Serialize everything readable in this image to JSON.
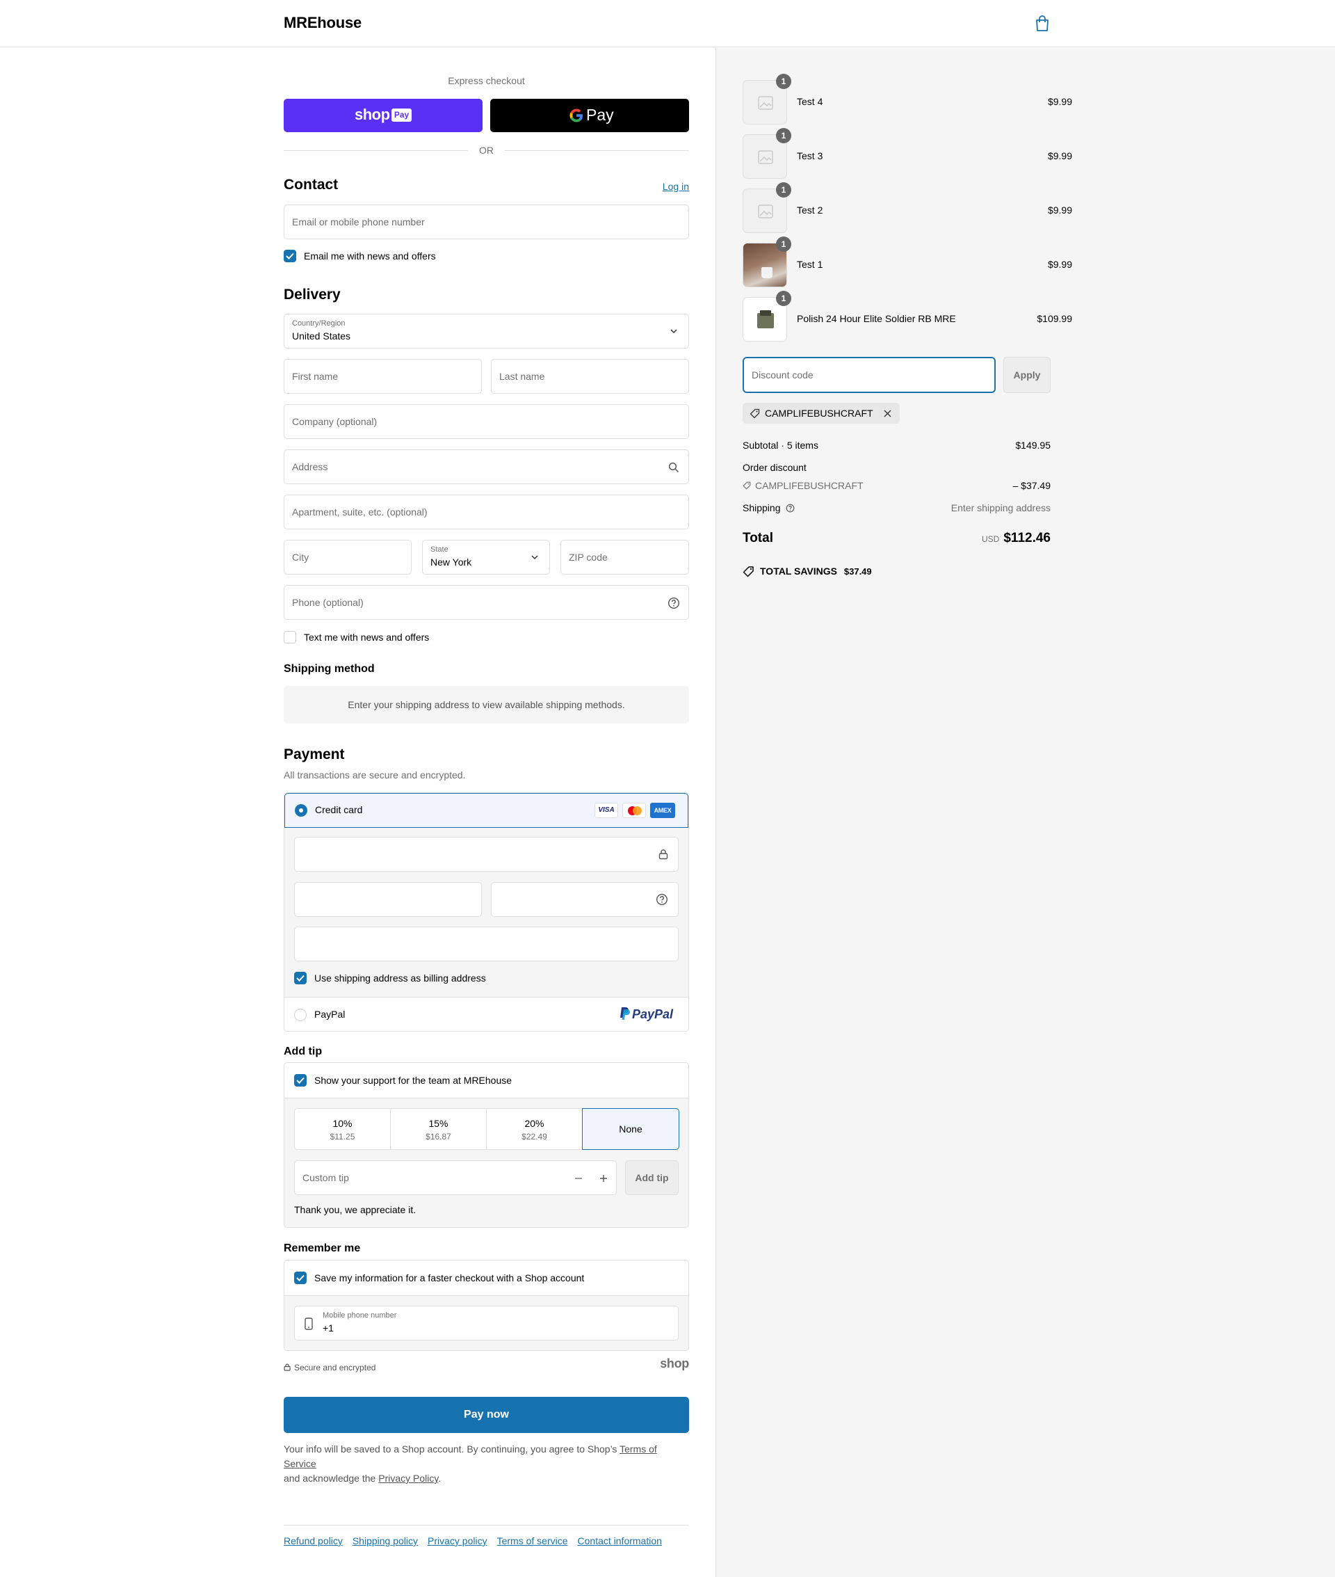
{
  "header": {
    "store_name": "MREhouse"
  },
  "express": {
    "title": "Express checkout",
    "shop_pay_word": "shop",
    "shop_pay_badge": "Pay",
    "gpay_word": "Pay",
    "or": "OR"
  },
  "contact": {
    "title": "Contact",
    "login": "Log in",
    "email_placeholder": "Email or mobile phone number",
    "news_label": "Email me with news and offers"
  },
  "delivery": {
    "title": "Delivery",
    "country_label": "Country/Region",
    "country_value": "United States",
    "first_name": "First name",
    "last_name": "Last name",
    "company": "Company (optional)",
    "address": "Address",
    "apartment": "Apartment, suite, etc. (optional)",
    "city": "City",
    "state_label": "State",
    "state_value": "New York",
    "zip": "ZIP code",
    "phone": "Phone (optional)",
    "text_label": "Text me with news and offers"
  },
  "shipping_method": {
    "title": "Shipping method",
    "notice": "Enter your shipping address to view available shipping methods."
  },
  "payment": {
    "title": "Payment",
    "subtitle": "All transactions are secure and encrypted.",
    "credit_card": "Credit card",
    "visa": "VISA",
    "amex": "AMEX",
    "billing_label": "Use shipping address as billing address",
    "paypal": "PayPal",
    "paypal_logo": "PayPal"
  },
  "tip": {
    "title": "Add tip",
    "support_label": "Show your support for the team at MREhouse",
    "options": [
      {
        "pct": "10%",
        "amt": "$11.25"
      },
      {
        "pct": "15%",
        "amt": "$16.87"
      },
      {
        "pct": "20%",
        "amt": "$22.49"
      },
      {
        "pct": "None",
        "amt": ""
      }
    ],
    "selected": "None",
    "custom_placeholder": "Custom tip",
    "add_button": "Add tip",
    "thanks": "Thank you, we appreciate it."
  },
  "remember": {
    "title": "Remember me",
    "save_label": "Save my information for a faster checkout with a Shop account",
    "phone_label": "Mobile phone number",
    "phone_value": "+1",
    "secure": "Secure and encrypted",
    "shop_logo": "shop"
  },
  "pay_now": "Pay now",
  "legal": {
    "text1": "Your info will be saved to a Shop account. By continuing, you agree to Shop’s ",
    "terms": "Terms of Service",
    "text2": "and acknowledge the ",
    "privacy": "Privacy Policy",
    "text3": "."
  },
  "footer_links": [
    "Refund policy",
    "Shipping policy",
    "Privacy policy",
    "Terms of service",
    "Contact information"
  ],
  "cart": {
    "items": [
      {
        "qty": "1",
        "name": "Test 4",
        "price": "$9.99"
      },
      {
        "qty": "1",
        "name": "Test 3",
        "price": "$9.99"
      },
      {
        "qty": "1",
        "name": "Test 2",
        "price": "$9.99"
      },
      {
        "qty": "1",
        "name": "Test 1",
        "price": "$9.99"
      },
      {
        "qty": "1",
        "name": "Polish 24 Hour Elite Soldier RB MRE",
        "price": "$109.99"
      }
    ],
    "discount_placeholder": "Discount code",
    "apply": "Apply",
    "applied_code": "CAMPLIFEBUSHCRAFT",
    "subtotal_label": "Subtotal · 5 items",
    "subtotal": "$149.95",
    "order_discount_label": "Order discount",
    "discount_code": "CAMPLIFEBUSHCRAFT",
    "discount_amount": "– $37.49",
    "shipping_label": "Shipping",
    "shipping_value": "Enter shipping address",
    "total_label": "Total",
    "currency": "USD",
    "total": "$112.46",
    "savings_label": "TOTAL SAVINGS",
    "savings": "$37.49"
  },
  "colors": {
    "accent": "#1773b0",
    "shop_pay": "#5a31f4",
    "background_right": "#f5f5f5"
  }
}
